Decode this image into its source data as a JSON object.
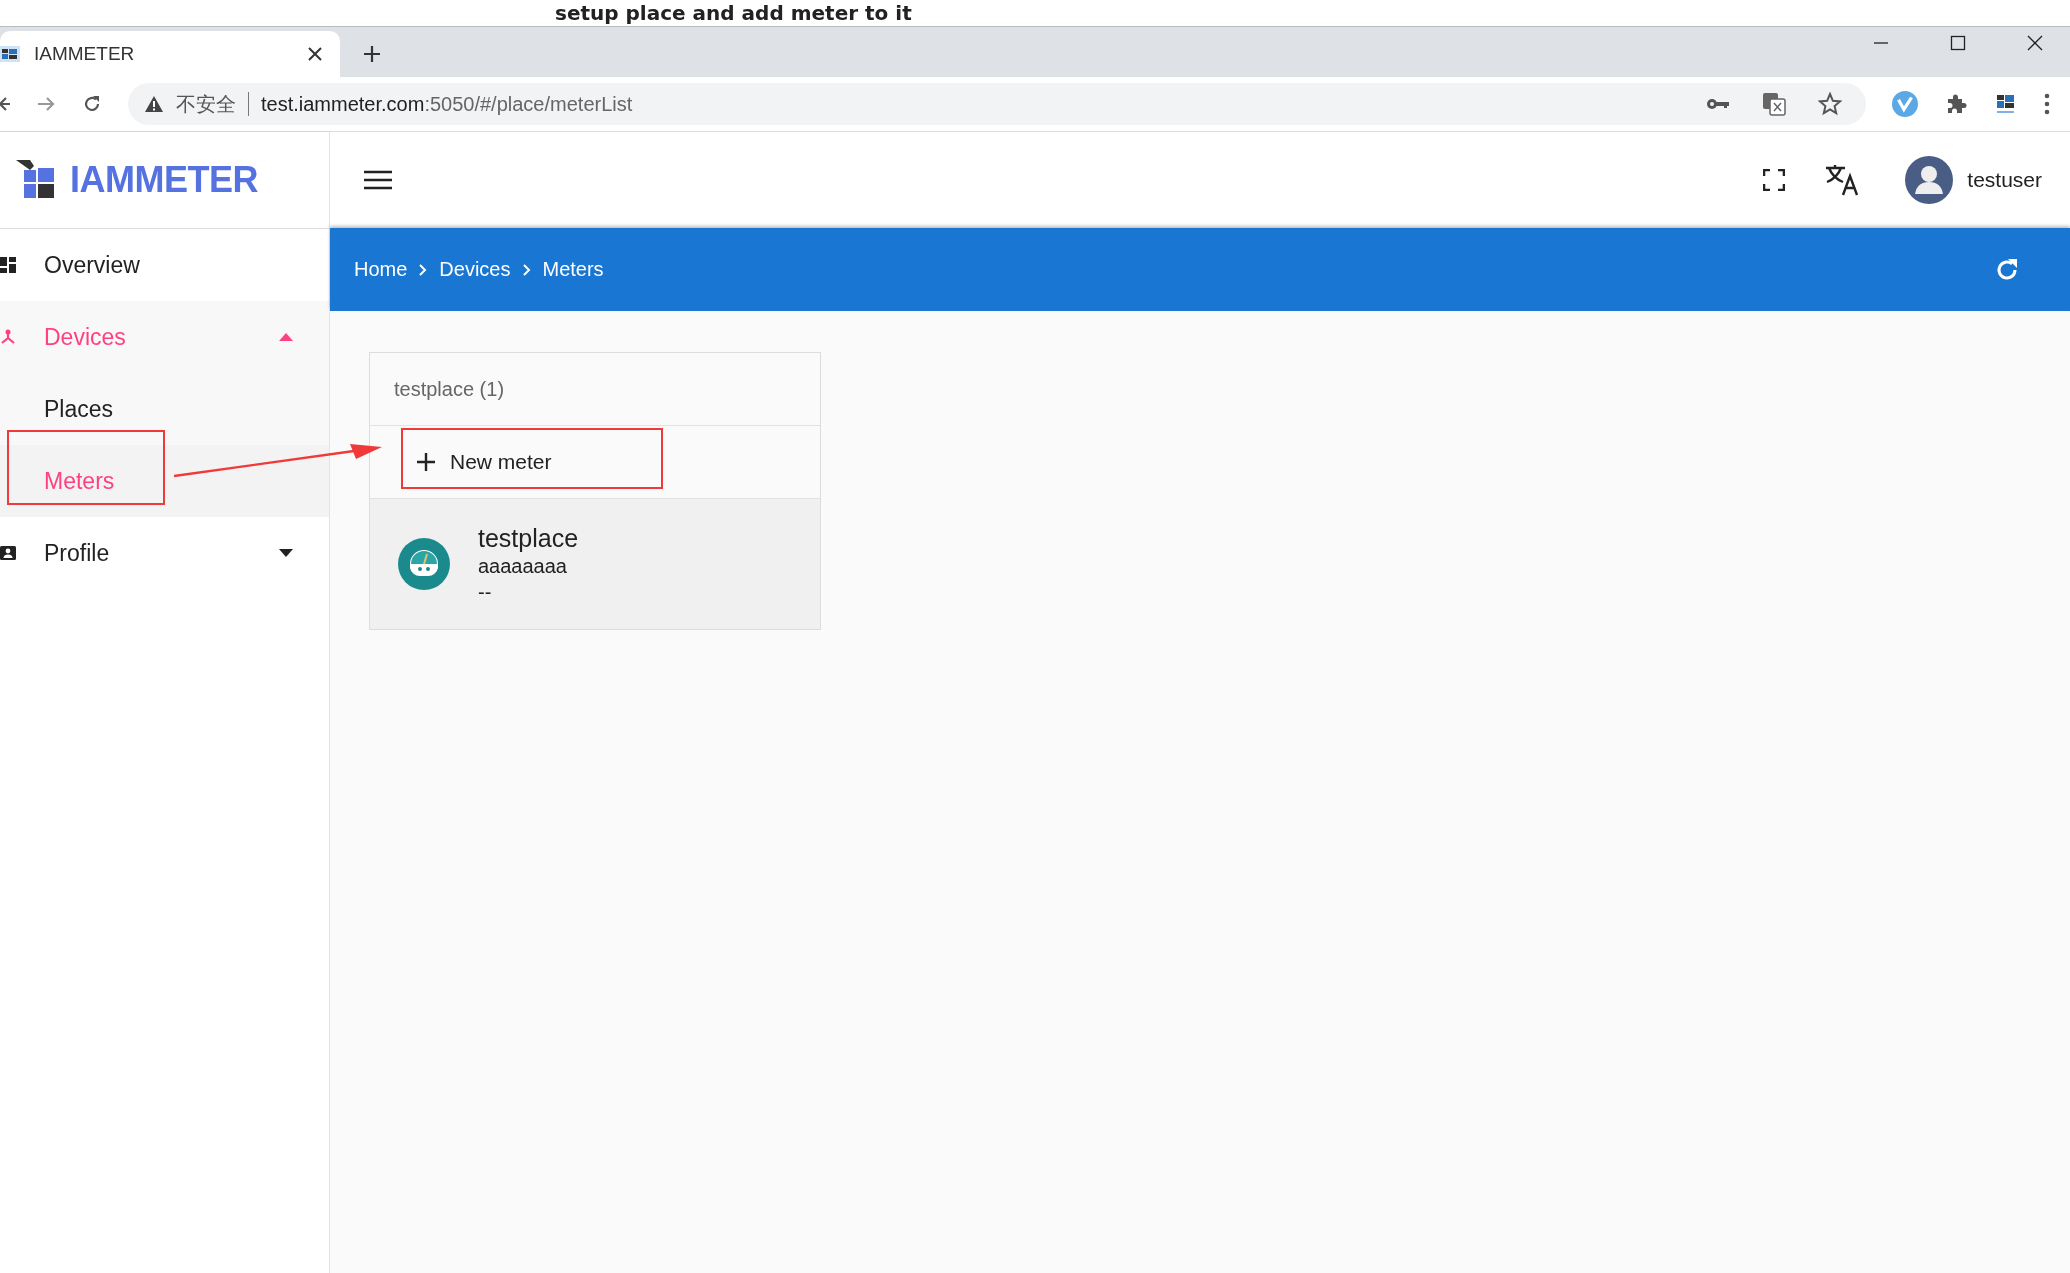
{
  "caption": "setup place and add meter to it",
  "browser": {
    "tab": {
      "title": "IAMMETER"
    },
    "address": {
      "security_label": "不安全",
      "host": "test.iammeter.com",
      "path": ":5050/#/place/meterList"
    }
  },
  "app": {
    "logo": "IAMMETER",
    "user": "testuser"
  },
  "sidebar": {
    "items": [
      {
        "label": "Overview",
        "kind": "link",
        "selected": false
      },
      {
        "label": "Devices",
        "kind": "group",
        "selected": true,
        "expanded": true,
        "children": [
          {
            "label": "Places",
            "selected": false
          },
          {
            "label": "Meters",
            "selected": true
          }
        ]
      },
      {
        "label": "Profile",
        "kind": "group",
        "selected": false,
        "expanded": false
      }
    ]
  },
  "breadcrumb": [
    "Home",
    "Devices",
    "Meters"
  ],
  "place_card": {
    "title": "testplace (1)",
    "new_button": "New meter",
    "meters": [
      {
        "name": "testplace",
        "serial": "aaaaaaaa",
        "value": "--"
      }
    ]
  }
}
